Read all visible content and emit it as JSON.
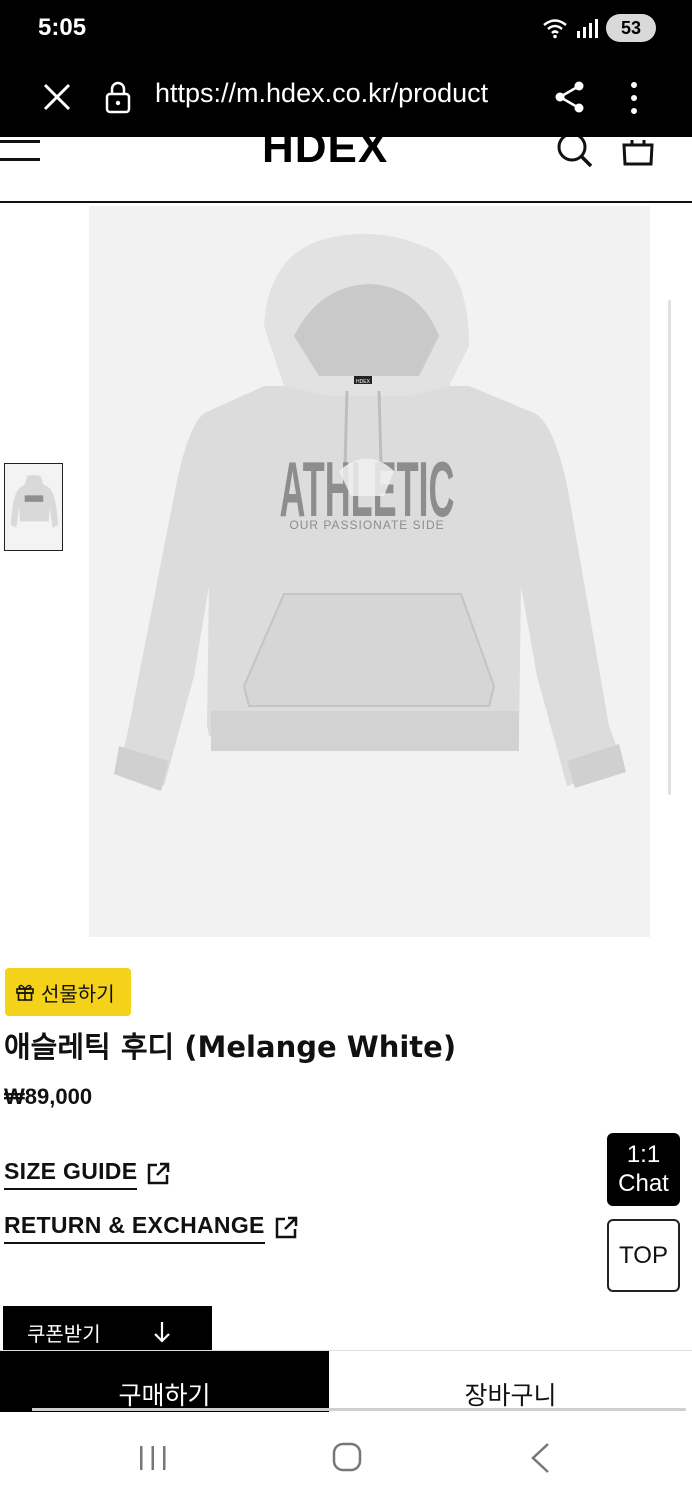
{
  "status_bar": {
    "time": "5:05",
    "battery": "53"
  },
  "browser": {
    "url": "https://m.hdex.co.kr/product"
  },
  "header": {
    "logo": "HDEX"
  },
  "product_image": {
    "print_main": "ATHLETIC",
    "print_sub": "OUR PASSIONATE SIDE",
    "neck_label": "HDEX",
    "color": "#dedede"
  },
  "product": {
    "gift_label": "선물하기",
    "name": "애슬레틱 후디 (Melange White)",
    "price": "₩89,000"
  },
  "links": {
    "size_guide": "SIZE GUIDE",
    "return_exchange": "RETURN & EXCHANGE"
  },
  "floating": {
    "chat_line1": "1:1",
    "chat_line2": "Chat",
    "top": "TOP"
  },
  "coupon": {
    "label": "쿠폰받기"
  },
  "actions": {
    "buy": "구매하기",
    "cart": "장바구니"
  },
  "colors": {
    "accent_yellow": "#f5d21a",
    "black": "#000000"
  },
  "icons": [
    "close-icon",
    "lock-icon",
    "share-icon",
    "more-icon",
    "menu-icon",
    "search-icon",
    "shopping-bag-icon",
    "gift-icon",
    "external-link-icon",
    "arrow-down-icon",
    "recent-apps-icon",
    "home-icon",
    "back-icon"
  ]
}
